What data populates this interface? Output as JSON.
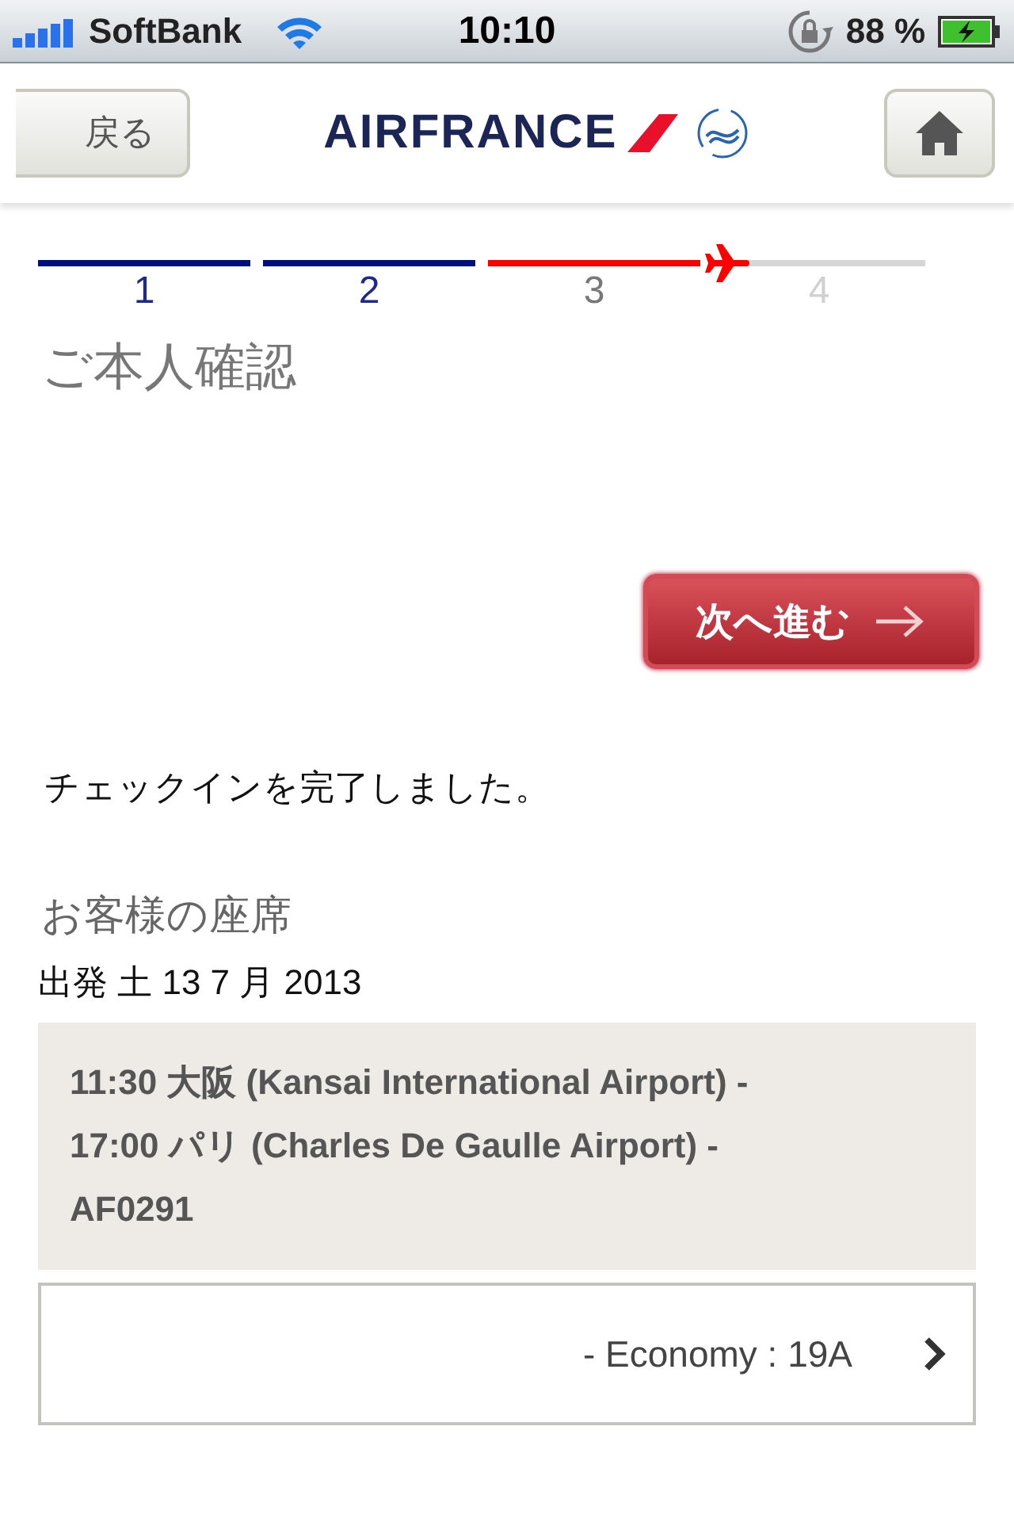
{
  "status_bar": {
    "carrier": "SoftBank",
    "time": "10:10",
    "battery": "88 %"
  },
  "header": {
    "back": "戻る",
    "logo": "AIRFRANCE"
  },
  "steps": [
    {
      "label": "1",
      "kind": "done"
    },
    {
      "label": "2",
      "kind": "done"
    },
    {
      "label": "3",
      "kind": "current"
    },
    {
      "label": "4",
      "kind": "pending"
    }
  ],
  "page_title": "ご本人確認",
  "next_button": "次へ進む",
  "message": "チェックインを完了しました。",
  "seats": {
    "heading": "お客様の座席",
    "departure": "出発 土 13 7 月 2013",
    "flight": [
      "11:30 大阪 (Kansai International Airport) -",
      "17:00 パリ (Charles De Gaulle Airport) -",
      "AF0291"
    ],
    "seat": "- Economy : 19A"
  }
}
